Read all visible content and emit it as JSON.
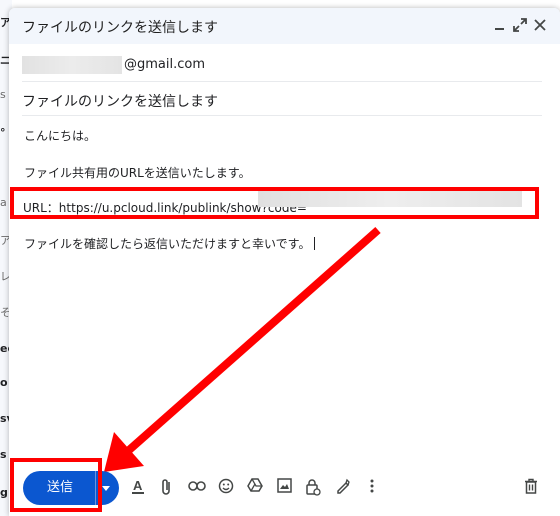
{
  "background": {
    "fragments": [
      "ア",
      "ニ",
      "s",
      "°",
      "a",
      "ア",
      "レ",
      "そ",
      "ed",
      "o",
      "sv",
      "s",
      "g"
    ]
  },
  "compose": {
    "title": "ファイルのリンクを送信します",
    "window_controls": {
      "minimize_icon": "minimize-icon",
      "expand_icon": "expand-icon",
      "close_icon": "close-icon"
    },
    "to": {
      "suffix": "@gmail.com"
    },
    "subject": "ファイルのリンクを送信します",
    "body": {
      "greeting": "こんにちは。",
      "line1": "ファイル共有用のURLを送信いたします。",
      "url_line": "URL：https://u.pcloud.link/publink/show?code=",
      "closing": "ファイルを確認したら返信いただけますと幸いです。"
    },
    "send_label": "送信",
    "toolbar_icons": [
      "text-format-icon",
      "attach-icon",
      "link-icon",
      "emoji-icon",
      "drive-icon",
      "image-icon",
      "confidential-lock-icon",
      "signature-pen-icon",
      "more-options-icon",
      "trash-icon"
    ]
  },
  "colors": {
    "send_button": "#0b57d0",
    "annotation": "#ff0000",
    "titlebar": "#f2f6fc"
  }
}
